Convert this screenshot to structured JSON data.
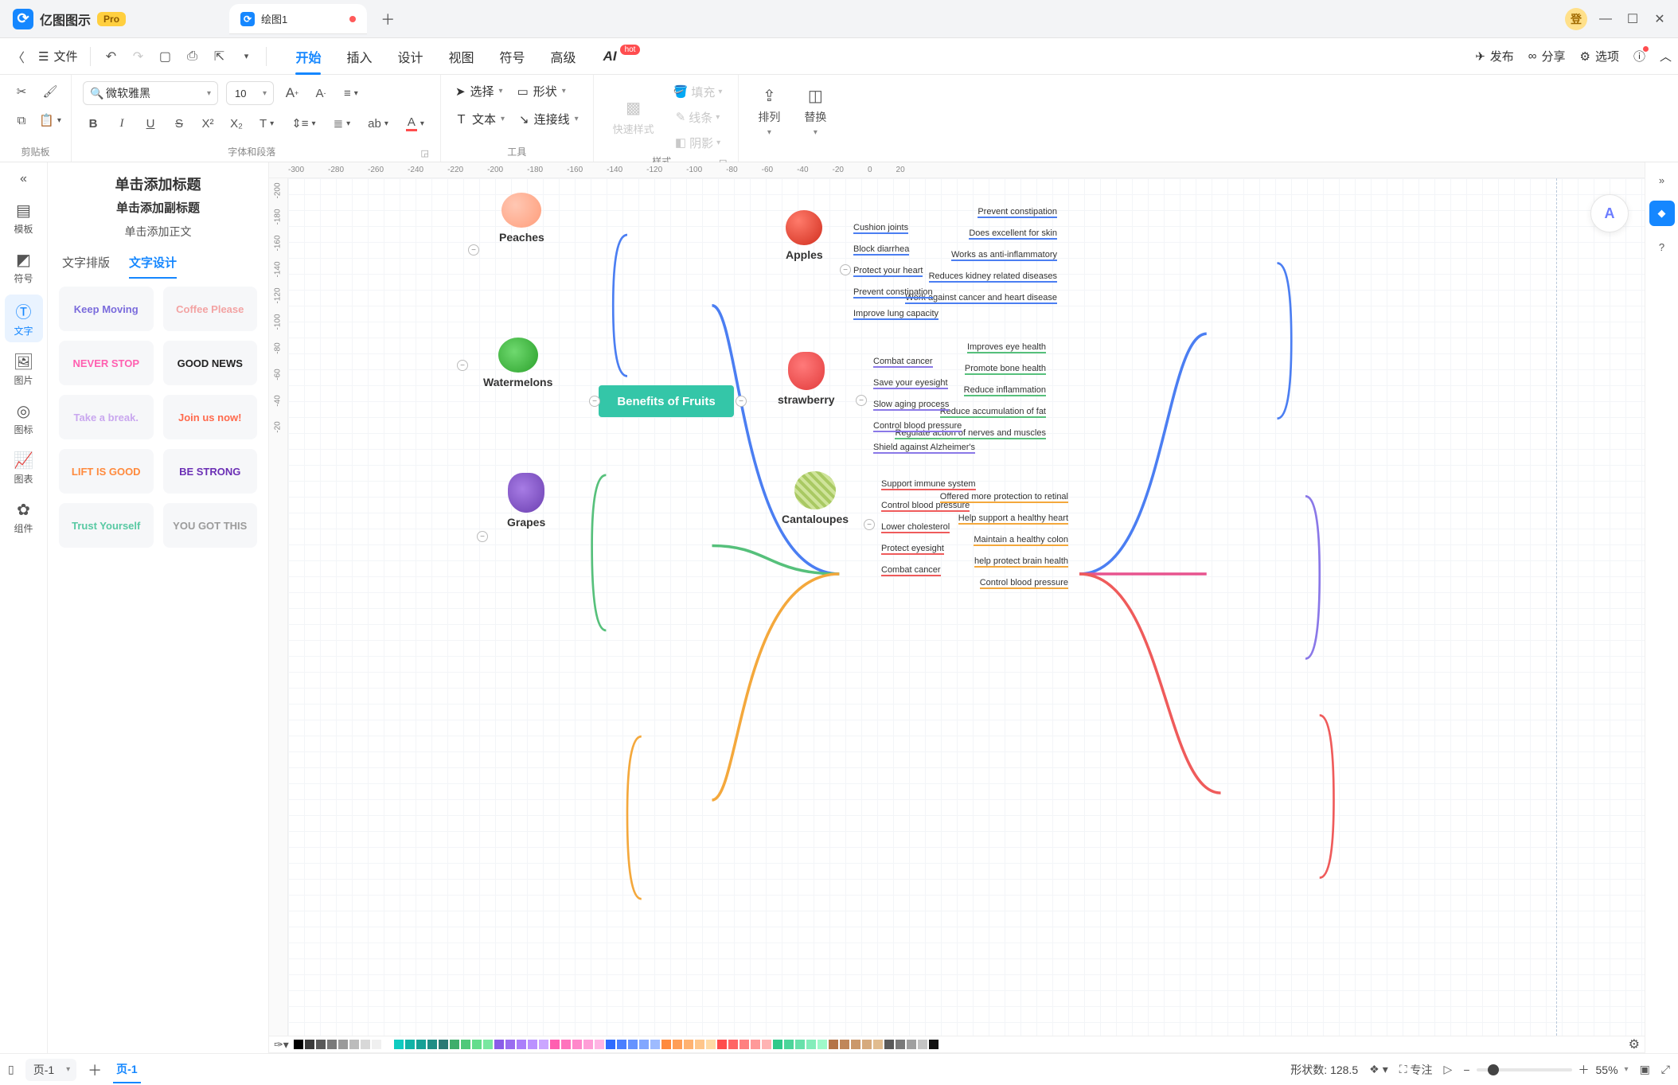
{
  "app": {
    "name": "亿图图示",
    "pro_badge": "Pro"
  },
  "tabs": {
    "doc_title": "绘图1",
    "add_tooltip": "+"
  },
  "window_controls": {
    "user_badge": "登"
  },
  "menu": {
    "file": "文件",
    "items": [
      "开始",
      "插入",
      "设计",
      "视图",
      "符号",
      "高级"
    ],
    "ai": "AI",
    "ai_badge": "hot",
    "right": {
      "publish": "发布",
      "share": "分享",
      "options": "选项"
    }
  },
  "ribbon": {
    "clipboard_label": "剪贴板",
    "font_group_label": "字体和段落",
    "font_family": "微软雅黑",
    "font_size": "10",
    "tools_label": "工具",
    "select_label": "选择",
    "shape_label": "形状",
    "text_label": "文本",
    "connector_label": "连接线",
    "quickstyle_label": "快速样式",
    "fill_label": "填充",
    "line_label": "线条",
    "shadow_label": "阴影",
    "style_label": "样式",
    "arrange_label": "排列",
    "replace_label": "替换"
  },
  "rail": {
    "items": [
      {
        "id": "templates",
        "label": "模板"
      },
      {
        "id": "symbols",
        "label": "符号"
      },
      {
        "id": "text",
        "label": "文字"
      },
      {
        "id": "images",
        "label": "图片"
      },
      {
        "id": "icons",
        "label": "图标"
      },
      {
        "id": "charts",
        "label": "图表"
      },
      {
        "id": "components",
        "label": "组件"
      }
    ]
  },
  "panel": {
    "title": "单击添加标题",
    "subtitle": "单击添加副标题",
    "body": "单击添加正文",
    "subtabs": {
      "layout": "文字排版",
      "design": "文字设计"
    },
    "cards": [
      {
        "text": "Keep Moving",
        "color": "#7a6bdc"
      },
      {
        "text": "Coffee Please",
        "color": "#f3a3a3"
      },
      {
        "text": "NEVER STOP",
        "color": "#ff5fb0"
      },
      {
        "text": "GOOD NEWS",
        "color": "#222"
      },
      {
        "text": "Take a break.",
        "color": "#c9a7ef"
      },
      {
        "text": "Join us now!",
        "color": "#ff6a4d"
      },
      {
        "text": "LIFT IS GOOD",
        "color": "#ff8a3d"
      },
      {
        "text": "BE STRONG",
        "color": "#6b2fb5"
      },
      {
        "text": "Trust Yourself",
        "color": "#58c9a3"
      },
      {
        "text": "YOU GOT THIS",
        "color": "#9b9b9b"
      }
    ]
  },
  "ruler_h": [
    "-300",
    "-280",
    "-260",
    "-240",
    "-220",
    "-200",
    "-180",
    "-160",
    "-140",
    "-120",
    "-100",
    "-80",
    "-60",
    "-40",
    "-20",
    "0",
    "20"
  ],
  "ruler_v": [
    "-200",
    "-180",
    "-160",
    "-140",
    "-120",
    "-100",
    "-80",
    "-60",
    "-40",
    "-20"
  ],
  "mindmap": {
    "central": "Benefits of Fruits",
    "left": [
      {
        "name": "Peaches",
        "color": "blue",
        "benefits": [
          "Prevent constipation",
          "Does excellent for skin",
          "Works as anti-inflammatory",
          "Reduces kidney related diseases",
          "Work against cancer and heart disease"
        ]
      },
      {
        "name": "Watermelons",
        "color": "green",
        "benefits": [
          "Improves eye health",
          "Promote bone health",
          "Reduce inflammation",
          "Reduce accumulation of fat",
          "Regulate action of nerves and muscles"
        ]
      },
      {
        "name": "Grapes",
        "color": "orange",
        "benefits": [
          "Offered more protection to retinal",
          "Help support a healthy heart",
          "Maintain a healthy colon",
          "help protect brain health",
          "Control blood pressure"
        ]
      }
    ],
    "right": [
      {
        "name": "Apples",
        "color": "blue",
        "benefits": [
          "Cushion joints",
          "Block diarrhea",
          "Protect your heart",
          "Prevent constipation",
          "Improve lung capacity"
        ]
      },
      {
        "name": "strawberry",
        "color": "purple",
        "benefits": [
          "Combat cancer",
          "Save your eyesight",
          "Slow aging process",
          "Control blood pressure",
          "Shield against Alzheimer's"
        ]
      },
      {
        "name": "Cantaloupes",
        "color": "red",
        "benefits": [
          "Support immune system",
          "Control blood pressure",
          "Lower cholesterol",
          "Protect eyesight",
          "Combat cancer"
        ]
      }
    ]
  },
  "colorstrip": [
    "#000000",
    "#3b3b3b",
    "#5a5a5a",
    "#7a7a7a",
    "#9a9a9a",
    "#bcbcbc",
    "#d8d8d8",
    "#f0f0f0",
    "#ffffff",
    "#0fcbc0",
    "#11b3a6",
    "#17a095",
    "#1f8d85",
    "#2b7a75",
    "#3fae6b",
    "#4fc97a",
    "#63dd8c",
    "#79e7a0",
    "#8a5ce8",
    "#9a6df0",
    "#ab7ffa",
    "#bb92ff",
    "#cba6ff",
    "#ff5fb0",
    "#ff73bd",
    "#ff88ca",
    "#ff9ed7",
    "#ffb4e4",
    "#2e6bff",
    "#4a7fff",
    "#6693ff",
    "#82a7ff",
    "#9ebbff",
    "#ff8a3d",
    "#ff9e57",
    "#ffb271",
    "#ffc68b",
    "#ffdaa5",
    "#ff4d4d",
    "#ff6666",
    "#ff8080",
    "#ff9999",
    "#ffb3b3",
    "#2fc98a",
    "#4bd59a",
    "#67e1aa",
    "#83edba",
    "#9ff9ca",
    "#b57447",
    "#c08659",
    "#cb986b",
    "#d6aa7d",
    "#e1bc8f",
    "#5a5a5a",
    "#7a7a7a",
    "#a0a0a0",
    "#c4c4c4",
    "#111111",
    "#ffffff"
  ],
  "status": {
    "page_dropdown": "页-1",
    "page_tab": "页-1",
    "shape_count_label": "形状数:",
    "shape_count_value": "128.5",
    "focus_label": "专注",
    "zoom_value": "55%"
  }
}
